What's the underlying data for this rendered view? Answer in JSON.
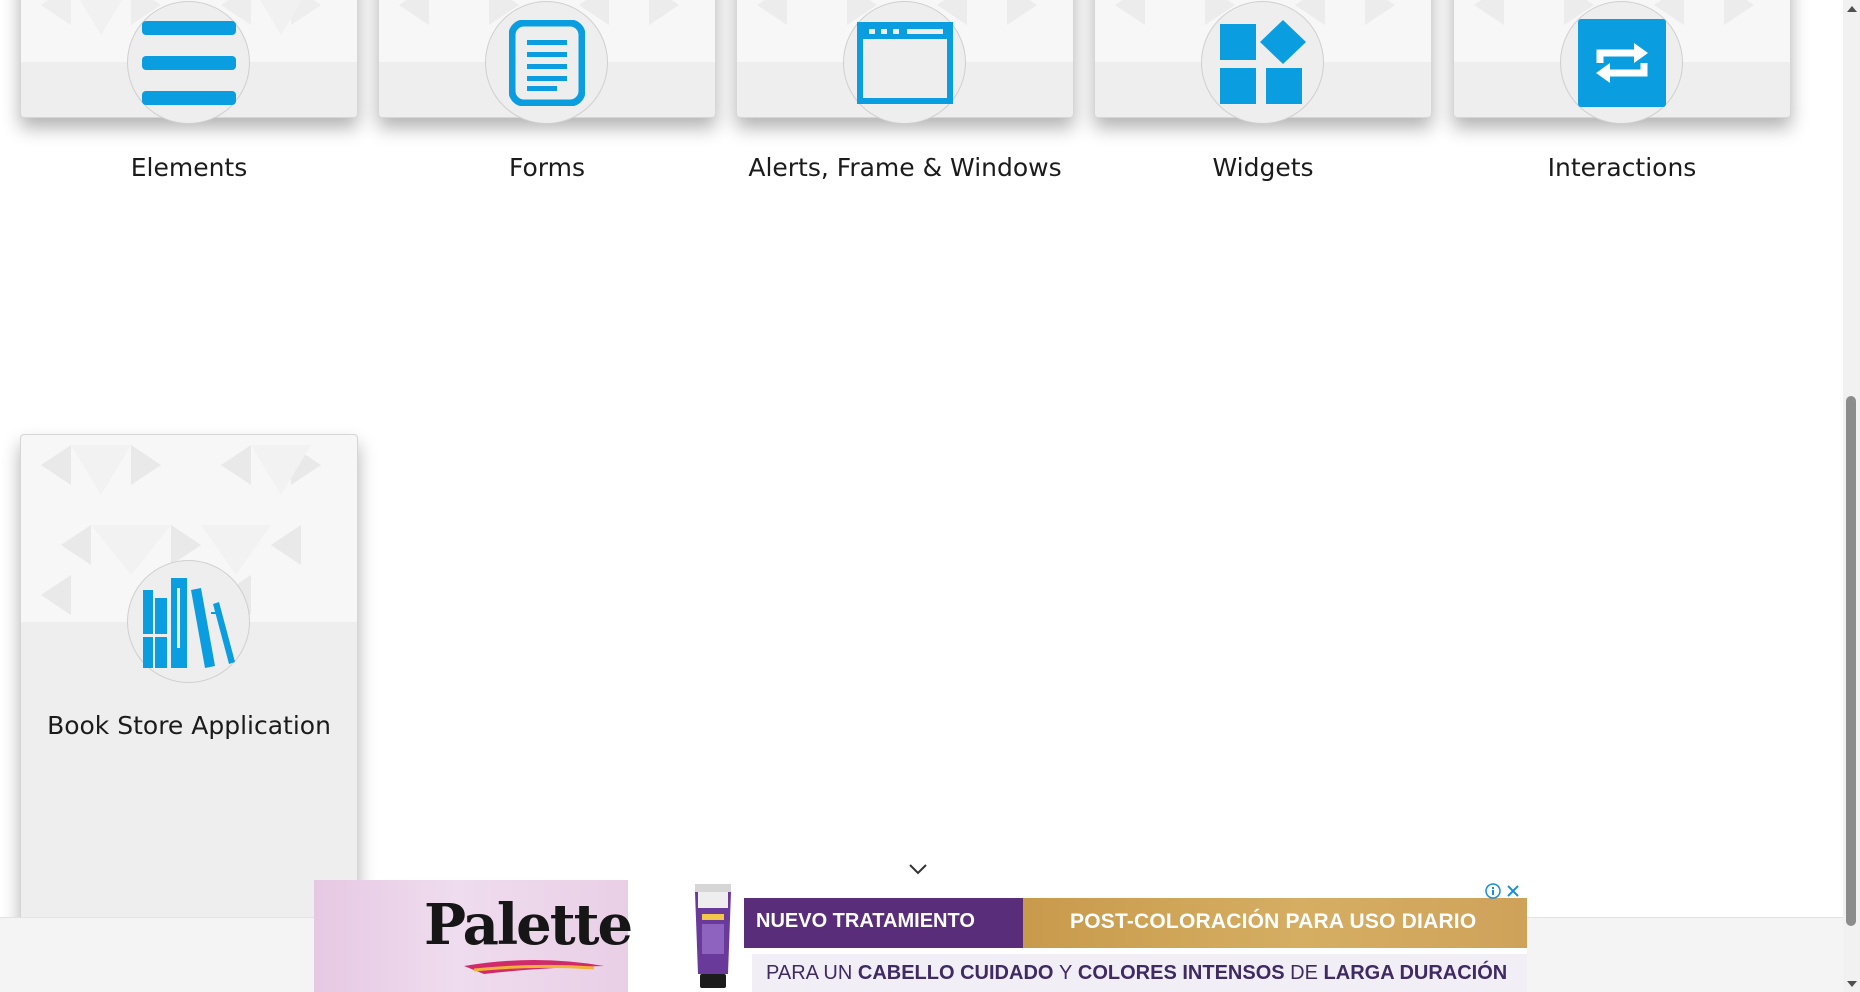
{
  "cards": [
    {
      "title": "Elements",
      "icon": "hamburger-lines-icon"
    },
    {
      "title": "Forms",
      "icon": "document-form-icon"
    },
    {
      "title": "Alerts, Frame & Windows",
      "icon": "browser-window-icon"
    },
    {
      "title": "Widgets",
      "icon": "widgets-blocks-icon"
    },
    {
      "title": "Interactions",
      "icon": "repeat-arrows-icon"
    },
    {
      "title": "Book Store Application",
      "icon": "books-icon"
    }
  ],
  "colors": {
    "accent": "#0a9ee0",
    "card_bg": "#eeeeee"
  },
  "ad": {
    "brand": "Palette",
    "headline_left": "NUEVO TRATAMIENTO",
    "headline_right": "POST-COLORACIÓN PARA USO DIARIO",
    "sub_1": "PARA UN ",
    "sub_2": "CABELLO CUIDADO",
    "sub_3": " Y ",
    "sub_4": "COLORES INTENSOS",
    "sub_5": " DE ",
    "sub_6": "LARGA DURACIÓN",
    "info_icon": "info-icon",
    "close_icon": "close-icon"
  }
}
